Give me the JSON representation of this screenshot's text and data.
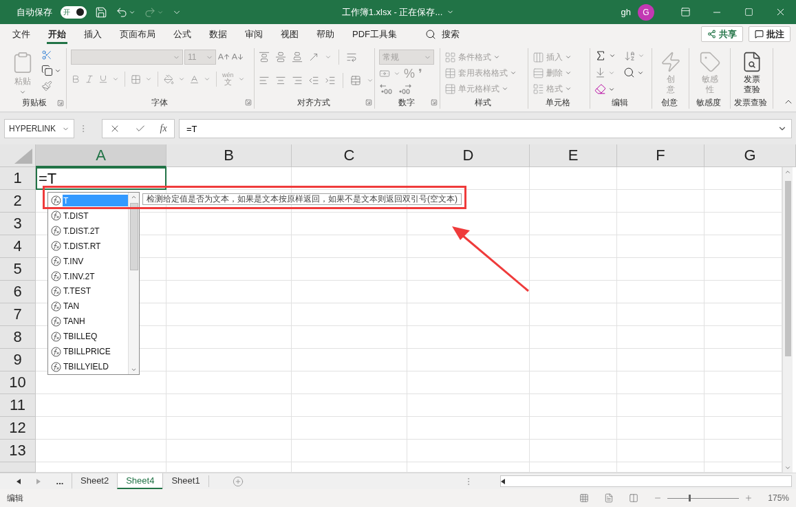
{
  "title_bar": {
    "autosave_label": "自动保存",
    "autosave_toggle": {
      "label": "开",
      "on": true
    },
    "title": "工作簿1.xlsx - 正在保存...",
    "user": "gh",
    "avatar": "G"
  },
  "menu_tabs": [
    {
      "label": "文件",
      "selected": false
    },
    {
      "label": "开始",
      "selected": true
    },
    {
      "label": "插入",
      "selected": false
    },
    {
      "label": "页面布局",
      "selected": false
    },
    {
      "label": "公式",
      "selected": false
    },
    {
      "label": "数据",
      "selected": false
    },
    {
      "label": "审阅",
      "selected": false
    },
    {
      "label": "视图",
      "selected": false
    },
    {
      "label": "帮助",
      "selected": false
    },
    {
      "label": "PDF工具集",
      "selected": false
    }
  ],
  "search": {
    "label": "搜索"
  },
  "share_button": "共享",
  "comments_button": "批注",
  "ribbon": {
    "groups": [
      {
        "kind": "clipboard",
        "label": "剪贴板",
        "launcher": true,
        "paste": {
          "label": "粘贴",
          "disabled": true
        }
      },
      {
        "kind": "font",
        "label": "字体",
        "launcher": true,
        "font_name": {
          "disabled": true
        },
        "font_size": {
          "value": "11",
          "disabled": true
        },
        "phonetic": {
          "top": "wén",
          "bottom": "文"
        }
      },
      {
        "kind": "alignment",
        "label": "对齐方式",
        "launcher": true
      },
      {
        "kind": "number",
        "label": "数字",
        "launcher": true,
        "format": {
          "value": "常规",
          "disabled": true
        },
        "symbols": [
          "%",
          "❜"
        ]
      },
      {
        "kind": "styles",
        "label": "样式",
        "launcher": false,
        "commands": [
          {
            "label": "条件格式",
            "disabled": true
          },
          {
            "label": "套用表格格式",
            "disabled": true
          },
          {
            "label": "单元格样式",
            "disabled": true
          }
        ]
      },
      {
        "kind": "cells",
        "label": "单元格",
        "launcher": false,
        "commands": [
          {
            "label": "插入",
            "disabled": true
          },
          {
            "label": "删除",
            "disabled": true
          },
          {
            "label": "格式",
            "disabled": true
          }
        ]
      },
      {
        "kind": "editing",
        "label": "编辑",
        "launcher": false
      },
      {
        "kind": "creativity",
        "label": "创意",
        "launcher": false,
        "button": {
          "label": "创意",
          "disabled": true
        }
      },
      {
        "kind": "sensitivity",
        "label": "敏感度",
        "launcher": false,
        "button": {
          "label": "敏感性",
          "disabled": true
        }
      },
      {
        "kind": "invoice",
        "label": "发票查验",
        "launcher": false,
        "button": {
          "label": "发票查验",
          "disabled": false
        }
      }
    ]
  },
  "formula_bar": {
    "name_box": "HYPERLINK",
    "insert_function": "fx",
    "formula": "=T"
  },
  "sheet": {
    "columns": [
      {
        "label": "A",
        "selected": true
      },
      {
        "label": "B",
        "selected": false
      },
      {
        "label": "C",
        "selected": false
      },
      {
        "label": "D",
        "selected": false
      },
      {
        "label": "E",
        "selected": false
      },
      {
        "label": "F",
        "selected": false
      },
      {
        "label": "G",
        "selected": false
      }
    ],
    "rows": [
      "1",
      "2",
      "3",
      "4",
      "5",
      "6",
      "7",
      "8",
      "9",
      "10",
      "11",
      "12",
      "13"
    ],
    "active_cell": {
      "value": "=T"
    }
  },
  "autocomplete": {
    "items": [
      {
        "label": "T",
        "selected": true
      },
      {
        "label": "T.DIST",
        "selected": false
      },
      {
        "label": "T.DIST.2T",
        "selected": false
      },
      {
        "label": "T.DIST.RT",
        "selected": false
      },
      {
        "label": "T.INV",
        "selected": false
      },
      {
        "label": "T.INV.2T",
        "selected": false
      },
      {
        "label": "T.TEST",
        "selected": false
      },
      {
        "label": "TAN",
        "selected": false
      },
      {
        "label": "TANH",
        "selected": false
      },
      {
        "label": "TBILLEQ",
        "selected": false
      },
      {
        "label": "TBILLPRICE",
        "selected": false
      },
      {
        "label": "TBILLYIELD",
        "selected": false
      }
    ],
    "tooltip": "检测给定值是否为文本，如果是文本按原样返回，如果不是文本则返回双引号(空文本)"
  },
  "sheet_tabs": {
    "overflow": "...",
    "tabs": [
      {
        "label": "Sheet2",
        "selected": false
      },
      {
        "label": "Sheet4",
        "selected": true
      },
      {
        "label": "Sheet1",
        "selected": false
      }
    ]
  },
  "status_bar": {
    "mode": "编辑",
    "zoom_slider": {
      "level": 0.3
    },
    "zoom": "175%"
  }
}
